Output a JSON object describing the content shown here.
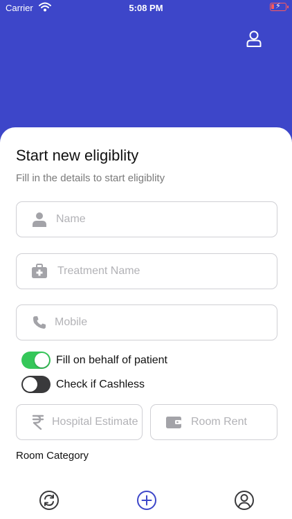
{
  "status_bar": {
    "carrier": "Carrier",
    "time": "5:08 PM"
  },
  "form": {
    "title": "Start new eligiblity",
    "subtitle": "Fill in the details to start eligiblity",
    "name_placeholder": "Name",
    "treatment_placeholder": "Treatment Name",
    "mobile_placeholder": "Mobile",
    "toggles": [
      {
        "label": "Fill on behalf of patient",
        "on": true
      },
      {
        "label": "Check if Cashless",
        "on": false
      }
    ],
    "hospital_estimate_placeholder": "Hospital Estimate",
    "room_rent_placeholder": "Room Rent",
    "room_category_label": "Room Category"
  },
  "colors": {
    "header": "#3d46c9",
    "toggle_on": "#35c759",
    "toggle_off": "#3a3a3c",
    "icon_gray": "#a3a3a8",
    "tab_icon": "#3a3a3c",
    "tab_add": "#3d46c9"
  },
  "icons": {
    "header": "user-icon",
    "name": "person-icon",
    "treatment": "medical-kit-icon",
    "mobile": "phone-icon",
    "hospital_estimate": "rupee-icon",
    "room_rent": "wallet-icon",
    "tabs": [
      "sync-icon",
      "add-circle-icon",
      "profile-circle-icon"
    ]
  }
}
